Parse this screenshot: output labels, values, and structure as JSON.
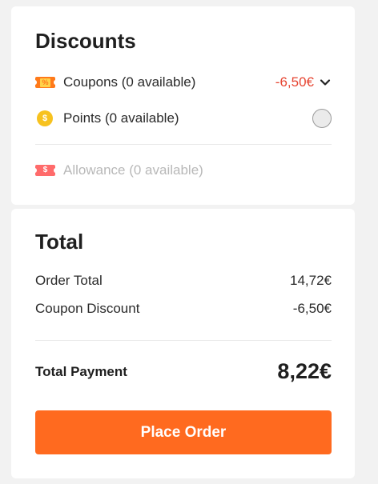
{
  "discounts": {
    "title": "Discounts",
    "coupons": {
      "icon": "coupon-icon",
      "icon_text": "%",
      "label": "Coupons (0 available)",
      "value": "-6,50€"
    },
    "points": {
      "icon": "coin-icon",
      "icon_text": "$",
      "label": "Points (0 available)"
    },
    "allowance": {
      "icon": "allowance-icon",
      "icon_text": "$",
      "label": "Allowance (0 available)"
    }
  },
  "total": {
    "title": "Total",
    "order_total_label": "Order Total",
    "order_total_value": "14,72€",
    "coupon_discount_label": "Coupon Discount",
    "coupon_discount_value": "-6,50€",
    "total_payment_label": "Total Payment",
    "total_payment_value": "8,22€",
    "place_order_label": "Place Order"
  },
  "colors": {
    "accent": "#ff6a1f",
    "discount_red": "#e64532",
    "coin_yellow": "#f7c21f",
    "allowance_red": "#ff6b6b"
  }
}
